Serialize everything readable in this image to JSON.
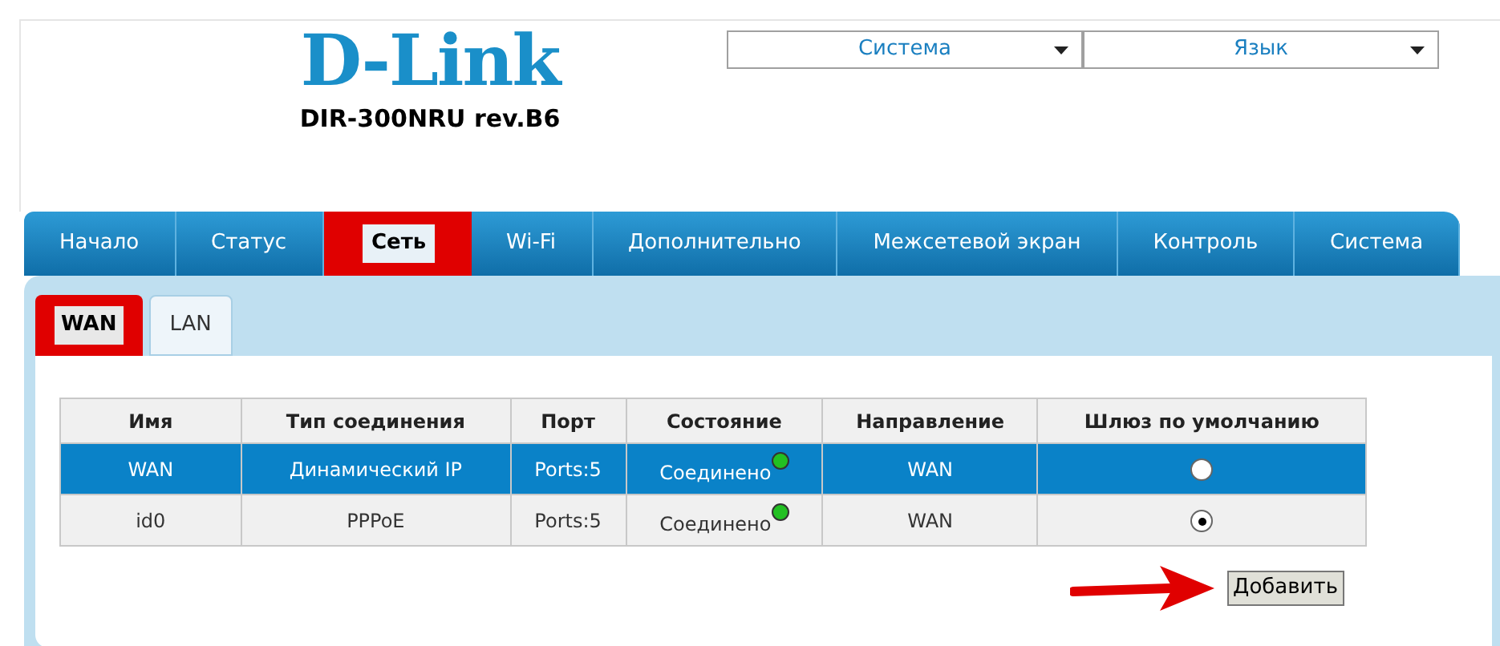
{
  "header": {
    "logo": "D-Link",
    "model": "DIR-300NRU rev.B6",
    "selects": [
      {
        "value": "Система"
      },
      {
        "value": "Язык"
      }
    ]
  },
  "tabs": [
    {
      "label": "Начало",
      "selected": false,
      "highlighted": false
    },
    {
      "label": "Статус",
      "selected": false,
      "highlighted": false
    },
    {
      "label": "Сеть",
      "selected": true,
      "highlighted": true
    },
    {
      "label": "Wi-Fi",
      "selected": false,
      "highlighted": false
    },
    {
      "label": "Дополнительно",
      "selected": false,
      "highlighted": false
    },
    {
      "label": "Межсетевой экран",
      "selected": false,
      "highlighted": false
    },
    {
      "label": "Контроль",
      "selected": false,
      "highlighted": false
    },
    {
      "label": "Система",
      "selected": false,
      "highlighted": false
    }
  ],
  "subtabs": [
    {
      "label": "WAN",
      "selected": true,
      "highlighted": true
    },
    {
      "label": "LAN",
      "selected": false,
      "highlighted": false
    }
  ],
  "table": {
    "columns": [
      "Имя",
      "Тип соединения",
      "Порт",
      "Состояние",
      "Направление",
      "Шлюз по умолчанию"
    ],
    "rows": [
      {
        "name": "WAN",
        "type": "Динамический IP",
        "port": "Ports:5",
        "status": "Соединено",
        "color": "#22c022",
        "direction": "WAN",
        "default_gateway": false,
        "selected": true
      },
      {
        "name": "id0",
        "type": "PPPoE",
        "port": "Ports:5",
        "status": "Соединено",
        "color": "#22c022",
        "direction": "WAN",
        "default_gateway": true,
        "selected": false
      }
    ]
  },
  "add_button": {
    "label": "Добавить",
    "pointed": true
  }
}
